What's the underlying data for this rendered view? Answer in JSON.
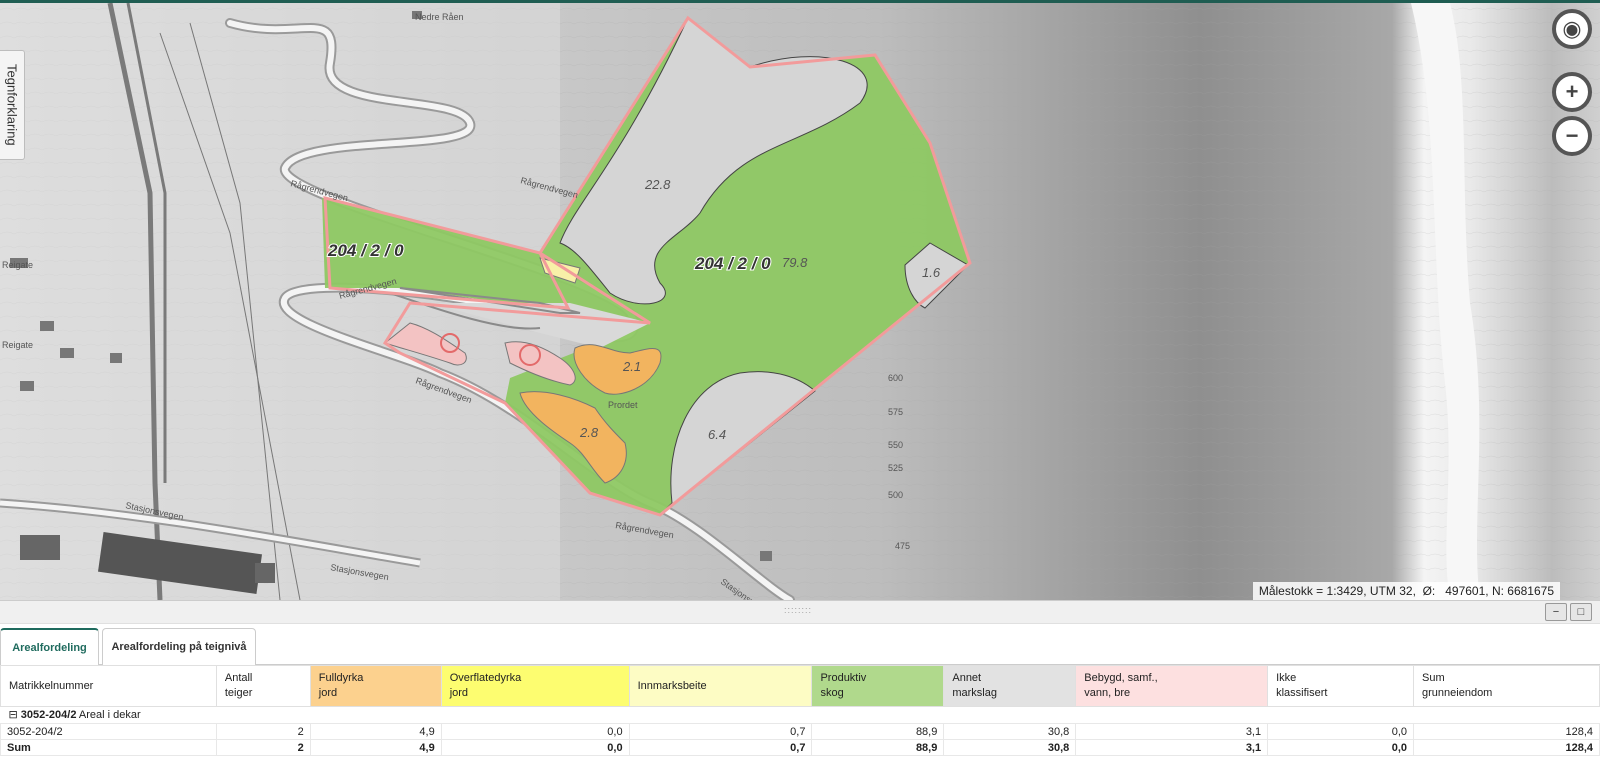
{
  "map": {
    "legend_tab_label": "Tegnforklaring",
    "buttons": [
      {
        "name": "locate",
        "icon": "locate-icon",
        "glyph": "◉"
      },
      {
        "name": "zoom-in",
        "icon": "zoom-in-icon",
        "glyph": "+"
      },
      {
        "name": "zoom-out",
        "icon": "zoom-out-icon",
        "glyph": "−"
      }
    ],
    "scale_readout": "Målestokk = 1:3429, UTM 32,  Ø:   497601, N: 6681675",
    "parcel_labels": [
      "204 / 2 / 0",
      "204 / 2 / 0"
    ],
    "area_labels": [
      "22.8",
      "79.8",
      "1.6",
      "2.1",
      "2.8",
      "6.4"
    ],
    "place_labels": [
      "Nedre Råen",
      "Rågrendvegen",
      "Rågrendvegen",
      "Rågrendvegen",
      "Rågrendvegen",
      "Rågrendvegen",
      "Stasjonsvegen",
      "Stasjonsvegen",
      "Stasjonsvegen",
      "Reigate",
      "Reigate",
      "Prordet"
    ],
    "contour_labels": [
      "600",
      "575",
      "550",
      "525",
      "500",
      "475"
    ],
    "colors": {
      "productive_forest": "#8ec863",
      "other": "#d5d5d5",
      "fully_cultivated": "#f2b45f",
      "pasture": "#f8f0a8",
      "built": "#f3c3c3",
      "parcel_border": "#f29b9b",
      "accent": "#1f6b5e"
    }
  },
  "panel": {
    "minimize_glyph": "−",
    "maximize_glyph": "□",
    "splitter_grip": "::::::::"
  },
  "tabs": [
    {
      "label": "Arealfordeling",
      "active": true
    },
    {
      "label": "Arealfordeling på teignivå",
      "active": false
    }
  ],
  "table": {
    "columns": [
      {
        "line1": "Matrikkelnummer",
        "line2": "",
        "color": "#ffffff"
      },
      {
        "line1": "Antall",
        "line2": "teiger",
        "color": "#ffffff"
      },
      {
        "line1": "Fulldyrka",
        "line2": "jord",
        "color": "#fcd18e"
      },
      {
        "line1": "Overflatedyrka",
        "line2": "jord",
        "color": "#fdfd70"
      },
      {
        "line1": "Innmarksbeite",
        "line2": "",
        "color": "#fdfcc4"
      },
      {
        "line1": "Produktiv",
        "line2": "skog",
        "color": "#b0d98c"
      },
      {
        "line1": "Annet",
        "line2": "markslag",
        "color": "#e2e2e2"
      },
      {
        "line1": "Bebygd, samf.,",
        "line2": "vann, bre",
        "color": "#fde0e0"
      },
      {
        "line1": "Ikke",
        "line2": "klassifisert",
        "color": "#ffffff"
      },
      {
        "line1": "Sum",
        "line2": "grunneiendom",
        "color": "#ffffff"
      }
    ],
    "group": {
      "toggle": "⊟",
      "id": "3052-204/2",
      "label": "Areal i dekar"
    },
    "rows": [
      {
        "cells": [
          "3052-204/2",
          "2",
          "4,9",
          "0,0",
          "0,7",
          "88,9",
          "30,8",
          "3,1",
          "0,0",
          "128,4"
        ]
      }
    ],
    "sum": {
      "cells": [
        "Sum",
        "2",
        "4,9",
        "0,0",
        "0,7",
        "88,9",
        "30,8",
        "3,1",
        "0,0",
        "128,4"
      ]
    }
  }
}
